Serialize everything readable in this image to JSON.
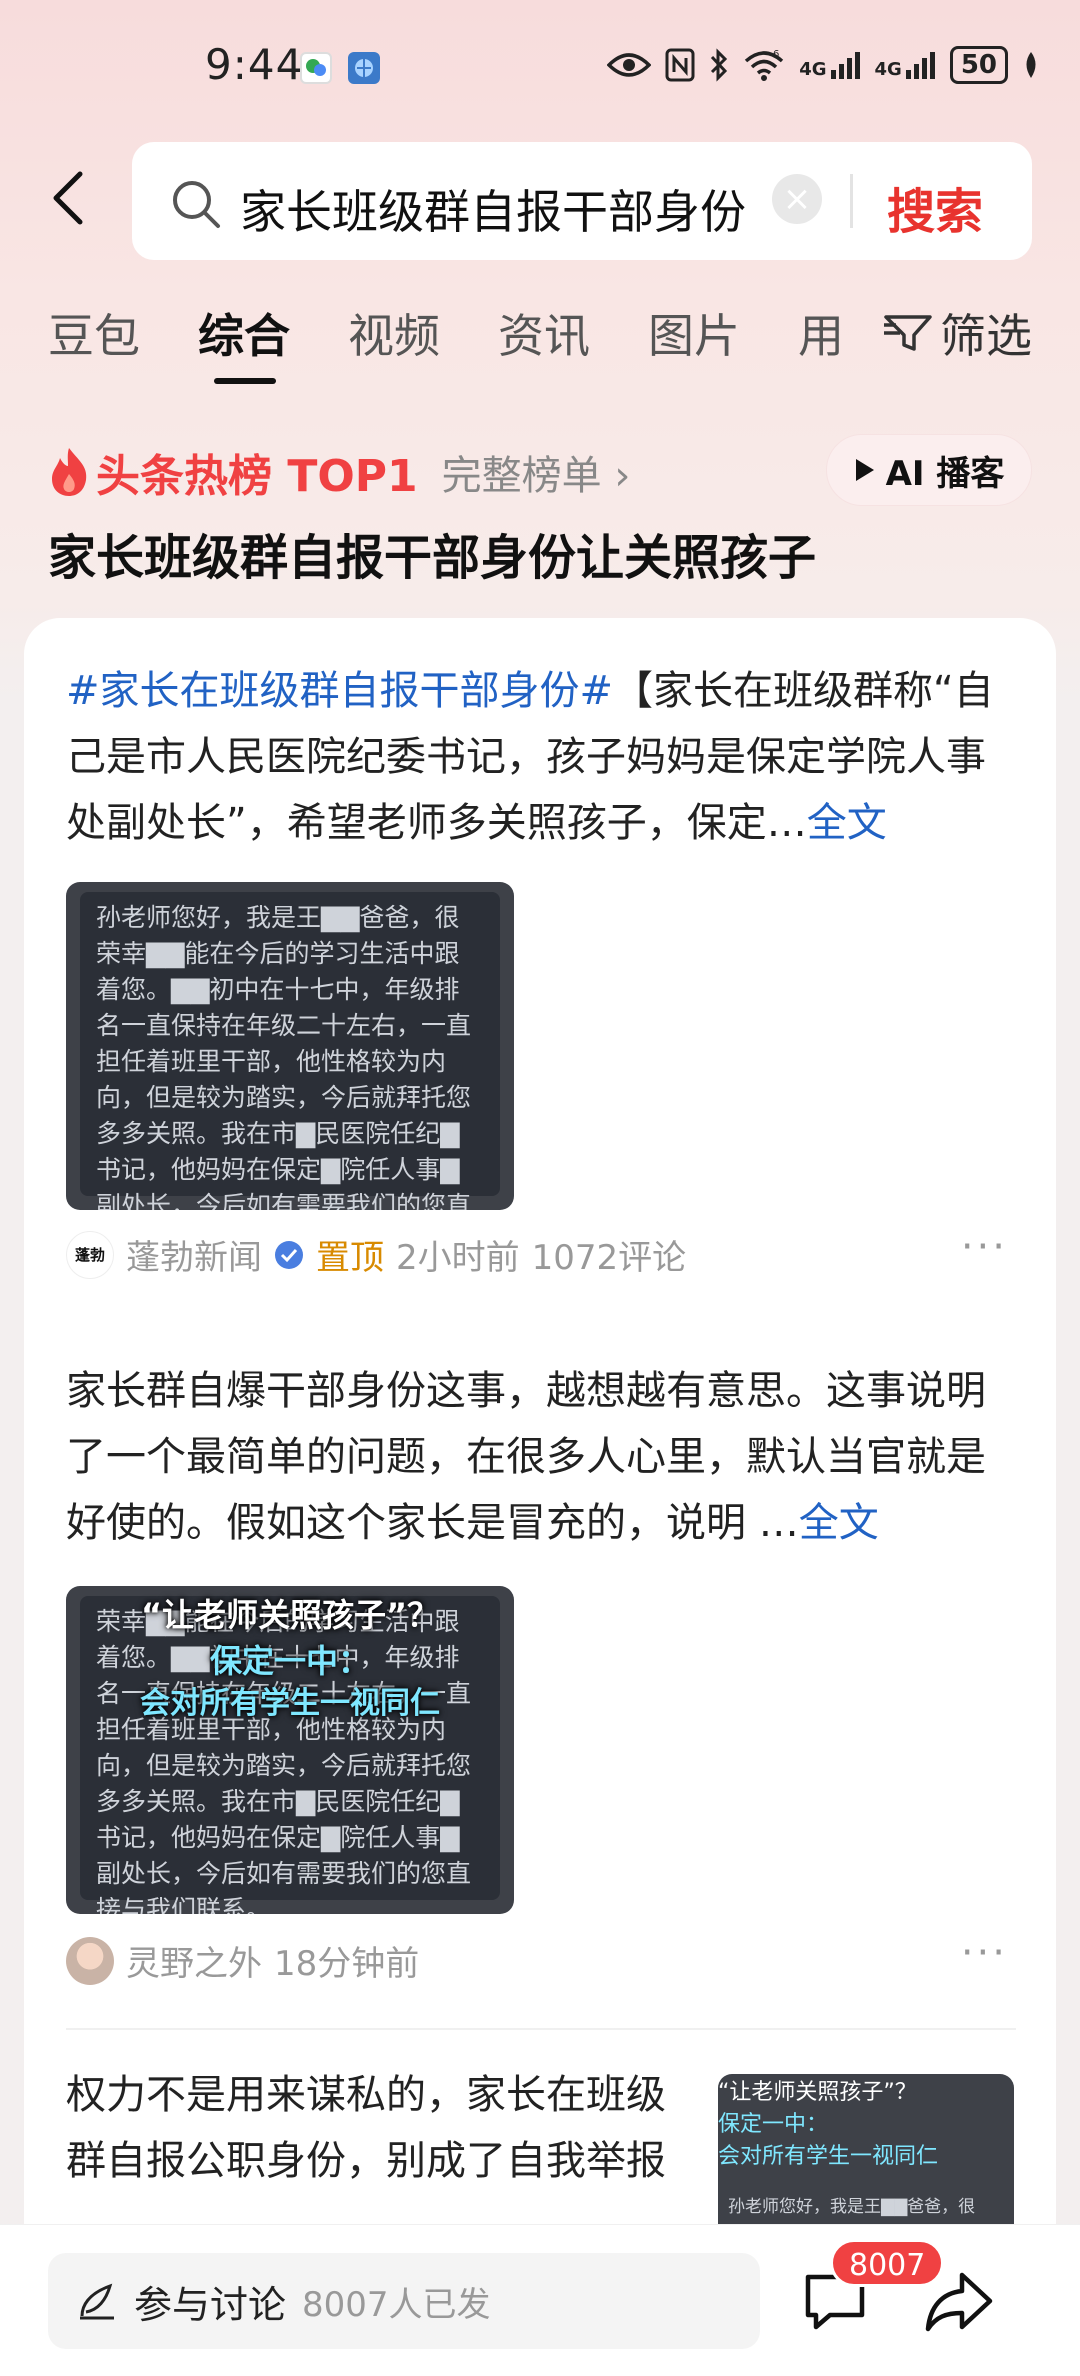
{
  "status_bar": {
    "time": "9:44",
    "network_6": "6",
    "net1": "4G",
    "net2": "4G",
    "battery": "50"
  },
  "search": {
    "query": "家长班级群自报干部身份",
    "button_label": "搜索"
  },
  "tabs": [
    {
      "label": "豆包",
      "active": false
    },
    {
      "label": "综合",
      "active": true
    },
    {
      "label": "视频",
      "active": false
    },
    {
      "label": "资讯",
      "active": false
    },
    {
      "label": "图片",
      "active": false
    },
    {
      "label": "用",
      "active": false
    }
  ],
  "filter_label": "筛选",
  "hot": {
    "label": "头条热榜 TOP1",
    "more": "完整榜单 ›",
    "ai_button": "AI 播客",
    "title": "家长班级群自报干部身份让关照孩子"
  },
  "posts": [
    {
      "hashtag": "#家长在班级群自报干部身份#",
      "text": "【家长在班级群称“自己是市人民医院纪委书记，孩子妈妈是保定学院人事处副处长”，希望老师多关照孩子，保定…",
      "full": "全文",
      "thumb_text": "孙老师您好，我是王▇▇爸爸，很荣幸▇▇能在今后的学习生活中跟着您。▇▇初中在十七中，年级排名一直保持在年级二十左右，一直担任着班里干部，他性格较为内向，但是较为踏实，今后就拜托您多多关照。我在市▇民医院任纪▇书记，他妈妈在保定▇院任人事▇副处长，今后如有需要我们的您直接与我们联系。",
      "source": "蓬勃新闻",
      "avatar_text": "蓬勃",
      "pinned": "置顶",
      "time": "2小时前",
      "comments": "1072评论"
    },
    {
      "text": "家长群自爆干部身份这事，越想越有意思。这事说明了一个最简单的问题，在很多人心里，默认当官就是好使的。假如这个家长是冒充的，说明 …",
      "full": "全文",
      "thumb_title": "“让老师关照孩子”？",
      "thumb_sub1": "保定一中：",
      "thumb_sub2": "会对所有学生一视同仁",
      "thumb_text": "荣幸▇▇能在今后的学习生活中跟着您。▇▇初中在十七中，年级排名一直保持在年级二十左右，一直担任着班里干部，他性格较为内向，但是较为踏实，今后就拜托您多多关照。我在市▇民医院任纪▇书记，他妈妈在保定▇院任人事▇副处长，今后如有需要我们的您直接与我们联系。",
      "source": "灵野之外",
      "time": "18分钟前"
    },
    {
      "text": "权力不是用来谋私的，家长在班级群自报公职身份，别成了自我举报",
      "thumb_title": "“让老师关照孩子”？",
      "thumb_sub1": "保定一中：",
      "thumb_sub2": "会对所有学生一视同仁",
      "thumb_text": "孙老师您好，我是王▇▇爸爸，很"
    }
  ],
  "bottom": {
    "discuss_label": "参与讨论",
    "discuss_count": "8007人已发",
    "badge": "8007"
  },
  "colors": {
    "accent_red": "#f04142",
    "link_blue": "#2162c4",
    "pin_orange": "#d88a00"
  }
}
